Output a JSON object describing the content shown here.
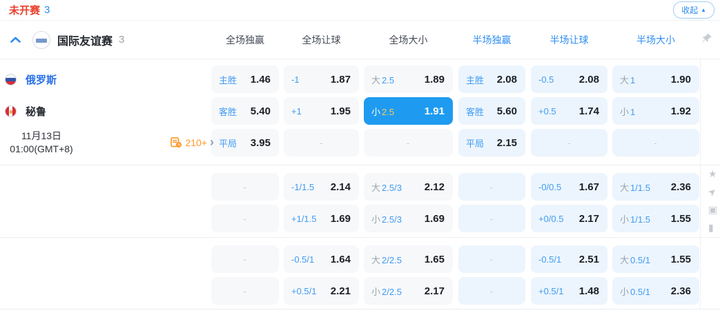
{
  "topbar": {
    "status": "未开赛",
    "count": "3",
    "collapse": {
      "label": "收起",
      "arrow": "▲"
    }
  },
  "league": {
    "name": "国际友谊赛",
    "count": "3"
  },
  "column_headers": [
    {
      "label": "全场独赢",
      "half": false
    },
    {
      "label": "全场让球",
      "half": false
    },
    {
      "label": "全场大小",
      "half": false
    },
    {
      "label": "半场独赢",
      "half": true
    },
    {
      "label": "半场让球",
      "half": true
    },
    {
      "label": "半场大小",
      "half": true
    }
  ],
  "match": {
    "home_team": "俄罗斯",
    "away_team": "秘鲁",
    "date": "11月13日",
    "time": "01:00(GMT+8)",
    "markets_count": "210+",
    "more_arrow": "›"
  },
  "colors": {
    "accent_blue": "#2d8cf0",
    "selected_blue": "#1e9bf0",
    "status_red": "#e8402d",
    "markets_orange": "#ff9a2a",
    "selected_handicap_gold": "#f6c95f",
    "full_cell_bg": "#f7f8fa",
    "half_cell_bg": "#ecf5fd"
  },
  "odds": {
    "empty_placeholder": "-",
    "rows": [
      [
        {
          "label": "主胜",
          "value": "1.46"
        },
        {
          "handicap": "-1",
          "value": "1.87"
        },
        {
          "prefix": "大",
          "handicap": "2.5",
          "value": "1.89"
        },
        {
          "label": "主胜",
          "value": "2.08"
        },
        {
          "handicap": "-0.5",
          "value": "2.08"
        },
        {
          "prefix": "大",
          "handicap": "1",
          "value": "1.90"
        }
      ],
      [
        {
          "label": "客胜",
          "value": "5.40"
        },
        {
          "handicap": "+1",
          "value": "1.95"
        },
        {
          "prefix": "小",
          "handicap": "2.5",
          "value": "1.91",
          "selected": true
        },
        {
          "label": "客胜",
          "value": "5.60"
        },
        {
          "handicap": "+0.5",
          "value": "1.74"
        },
        {
          "prefix": "小",
          "handicap": "1",
          "value": "1.92"
        }
      ],
      [
        {
          "label": "平局",
          "value": "3.95"
        },
        {
          "empty": true
        },
        {
          "empty": true
        },
        {
          "label": "平局",
          "value": "2.15"
        },
        {
          "empty": true
        },
        {
          "empty": true
        }
      ],
      [
        {
          "empty": true
        },
        {
          "handicap": "-1/1.5",
          "value": "2.14"
        },
        {
          "prefix": "大",
          "handicap": "2.5/3",
          "value": "2.12"
        },
        {
          "empty": true
        },
        {
          "handicap": "-0/0.5",
          "value": "1.67"
        },
        {
          "prefix": "大",
          "handicap": "1/1.5",
          "value": "2.36"
        }
      ],
      [
        {
          "empty": true
        },
        {
          "handicap": "+1/1.5",
          "value": "1.69"
        },
        {
          "prefix": "小",
          "handicap": "2.5/3",
          "value": "1.69"
        },
        {
          "empty": true
        },
        {
          "handicap": "+0/0.5",
          "value": "2.17"
        },
        {
          "prefix": "小",
          "handicap": "1/1.5",
          "value": "1.55"
        }
      ],
      [
        {
          "empty": true
        },
        {
          "handicap": "-0.5/1",
          "value": "1.64"
        },
        {
          "prefix": "大",
          "handicap": "2/2.5",
          "value": "1.65"
        },
        {
          "empty": true
        },
        {
          "handicap": "-0.5/1",
          "value": "2.51"
        },
        {
          "prefix": "大",
          "handicap": "0.5/1",
          "value": "1.55"
        }
      ],
      [
        {
          "empty": true
        },
        {
          "handicap": "+0.5/1",
          "value": "2.21"
        },
        {
          "prefix": "小",
          "handicap": "2/2.5",
          "value": "2.17"
        },
        {
          "empty": true
        },
        {
          "handicap": "+0.5/1",
          "value": "1.48"
        },
        {
          "prefix": "小",
          "handicap": "0.5/1",
          "value": "2.36"
        }
      ]
    ]
  }
}
